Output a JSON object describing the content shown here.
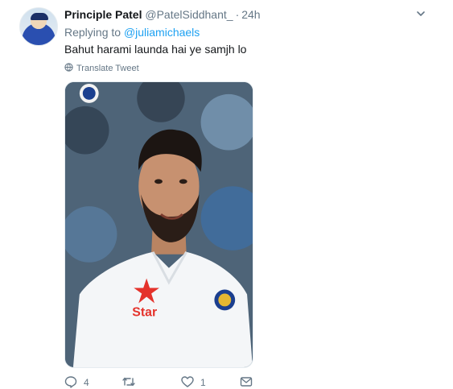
{
  "tweet": {
    "display_name": "Principle Patel",
    "handle": "@PatelSiddhant_",
    "separator": "·",
    "time": "24h",
    "replying_prefix": "Replying to ",
    "replying_to": "@juliamichaels",
    "text": "Bahut harami launda hai ye samjh lo",
    "translate_label": "Translate Tweet",
    "media_sponsor_text": "Star",
    "actions": {
      "reply_count": "4",
      "retweet_count": "",
      "like_count": "1"
    }
  },
  "icons": {
    "caret": "chevron-down-icon",
    "globe": "globe-icon",
    "reply": "reply-icon",
    "retweet": "retweet-icon",
    "like": "heart-icon",
    "dm": "envelope-icon"
  },
  "colors": {
    "link": "#1da1f2",
    "muted": "#657786",
    "text": "#14171a",
    "star": "#e4322b",
    "jersey": "#f4f6f8"
  }
}
